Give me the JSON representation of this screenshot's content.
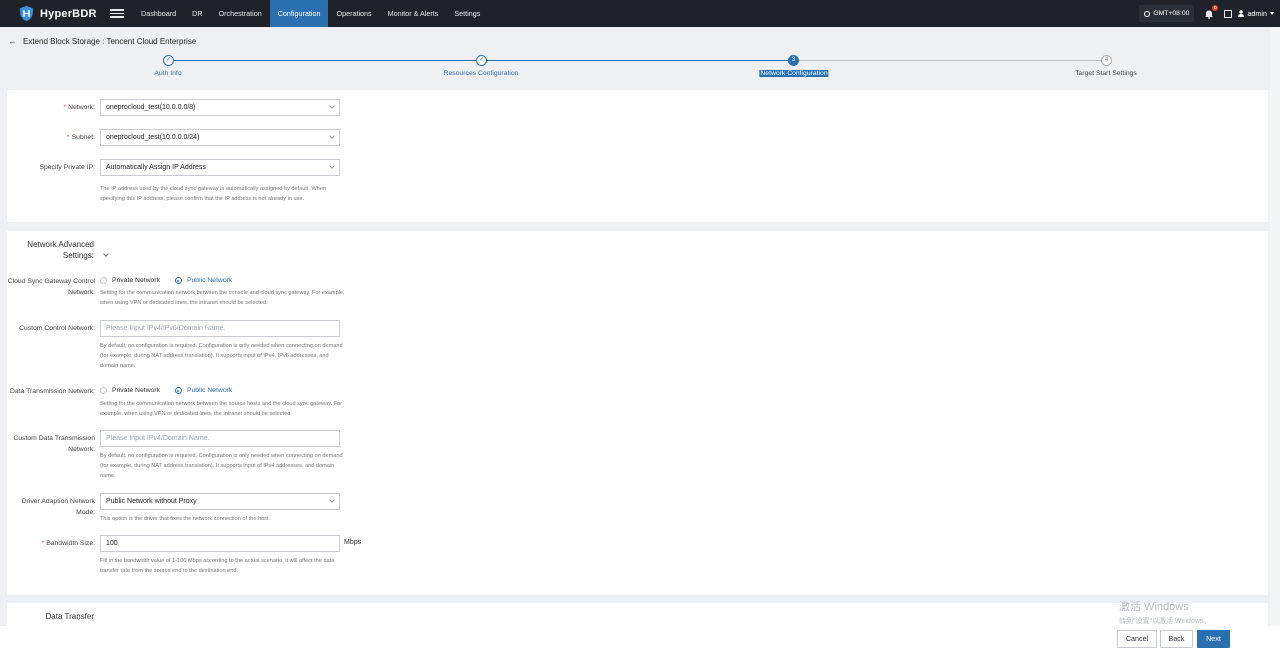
{
  "brand": {
    "name": "HyperBDR"
  },
  "nav": {
    "items": [
      {
        "label": "Dashboard"
      },
      {
        "label": "DR"
      },
      {
        "label": "Orchestration"
      },
      {
        "label": "Configuration"
      },
      {
        "label": "Operations"
      },
      {
        "label": "Monitor & Alerts"
      },
      {
        "label": "Settings"
      }
    ],
    "active": "Configuration"
  },
  "topbar": {
    "timezone": "GMT+08:00",
    "notification_count": "0",
    "user": "admin"
  },
  "page": {
    "title": "Extend Block Storage : Tencent Cloud Enterprise"
  },
  "steps": [
    {
      "label": "Auth Info",
      "marker": "✓",
      "state": "done"
    },
    {
      "label": "Resources Configuration",
      "marker": "✓",
      "state": "done"
    },
    {
      "label": "Network Configuration",
      "marker": "3",
      "state": "current"
    },
    {
      "label": "Target Start Settings",
      "marker": "4",
      "state": "future"
    }
  ],
  "network_section": {
    "network": {
      "label": "Network:",
      "value": "oneprocloud_test(10.0.0.0/8)"
    },
    "subnet": {
      "label": "Subnet:",
      "value": "oneprocloud_test(10.0.0.0/24)"
    },
    "private_ip": {
      "label": "Specify Private IP:",
      "value": "Automatically Assign IP Address",
      "help": "The IP address used by the cloud sync gateway is automatically assigned by default. When specifying this IP address, please confirm that the IP address is not already in use."
    }
  },
  "advanced": {
    "title": "Network Advanced Settings:",
    "control_network": {
      "label": "Cloud Sync Gateway Control Network:",
      "options": [
        "Private Network",
        "Public Network"
      ],
      "selected": "Public Network",
      "help": "Setting for the communication network between the console and cloud sync gateway. For example, when using VPN or dedicated lines, the intranet should be selected."
    },
    "custom_control": {
      "label": "Custom Control Network:",
      "placeholder": "Please Input IPv4/IPv6/Domain Name.",
      "help": "By default, no configuration is required. Configuration is only needed when connecting on demand (for example, during NAT address translation). It supports input of IPv4, IPv6 addresses, and domain name."
    },
    "data_transmission": {
      "label": "Data Transmission Network:",
      "options": [
        "Private Network",
        "Public Network"
      ],
      "selected": "Public Network",
      "help": "Setting for the communication network between the source hosts and the cloud sync gateway. For example, when using VPN or dedicated lines, the intranet should be selected."
    },
    "custom_data": {
      "label": "Custom Data Transmission Network:",
      "placeholder": "Please Input IPv4/Domain Name.",
      "help": "By default, no configuration is required. Configuration is only needed when connecting on demand (for example, during NAT address translation). It supports input of IPv4 addresses, and domain name."
    },
    "driver_mode": {
      "label": "Driver Adaption Network Mode:",
      "value": "Public Network without Proxy",
      "help": "This option is the driver that fixes the network connection of the host."
    },
    "bandwidth": {
      "label": "Bandwidth Size:",
      "value": "100",
      "unit": "Mbps",
      "help": "Fill in the bandwidth value of 1-100 Mbps according to the actual scenario, it will affect the data transfer rate from the source end to the destination end."
    }
  },
  "data_transfer": {
    "title": "Data Transfer"
  },
  "footer": {
    "cancel": "Cancel",
    "back": "Back",
    "next": "Next"
  },
  "watermark": {
    "line1": "激活 Windows",
    "line2": "转到\"设置\"以激活 Windows。"
  },
  "colors": {
    "primary": "#2a6fb0",
    "topbar": "#1f2329",
    "required": "#e0402f"
  }
}
